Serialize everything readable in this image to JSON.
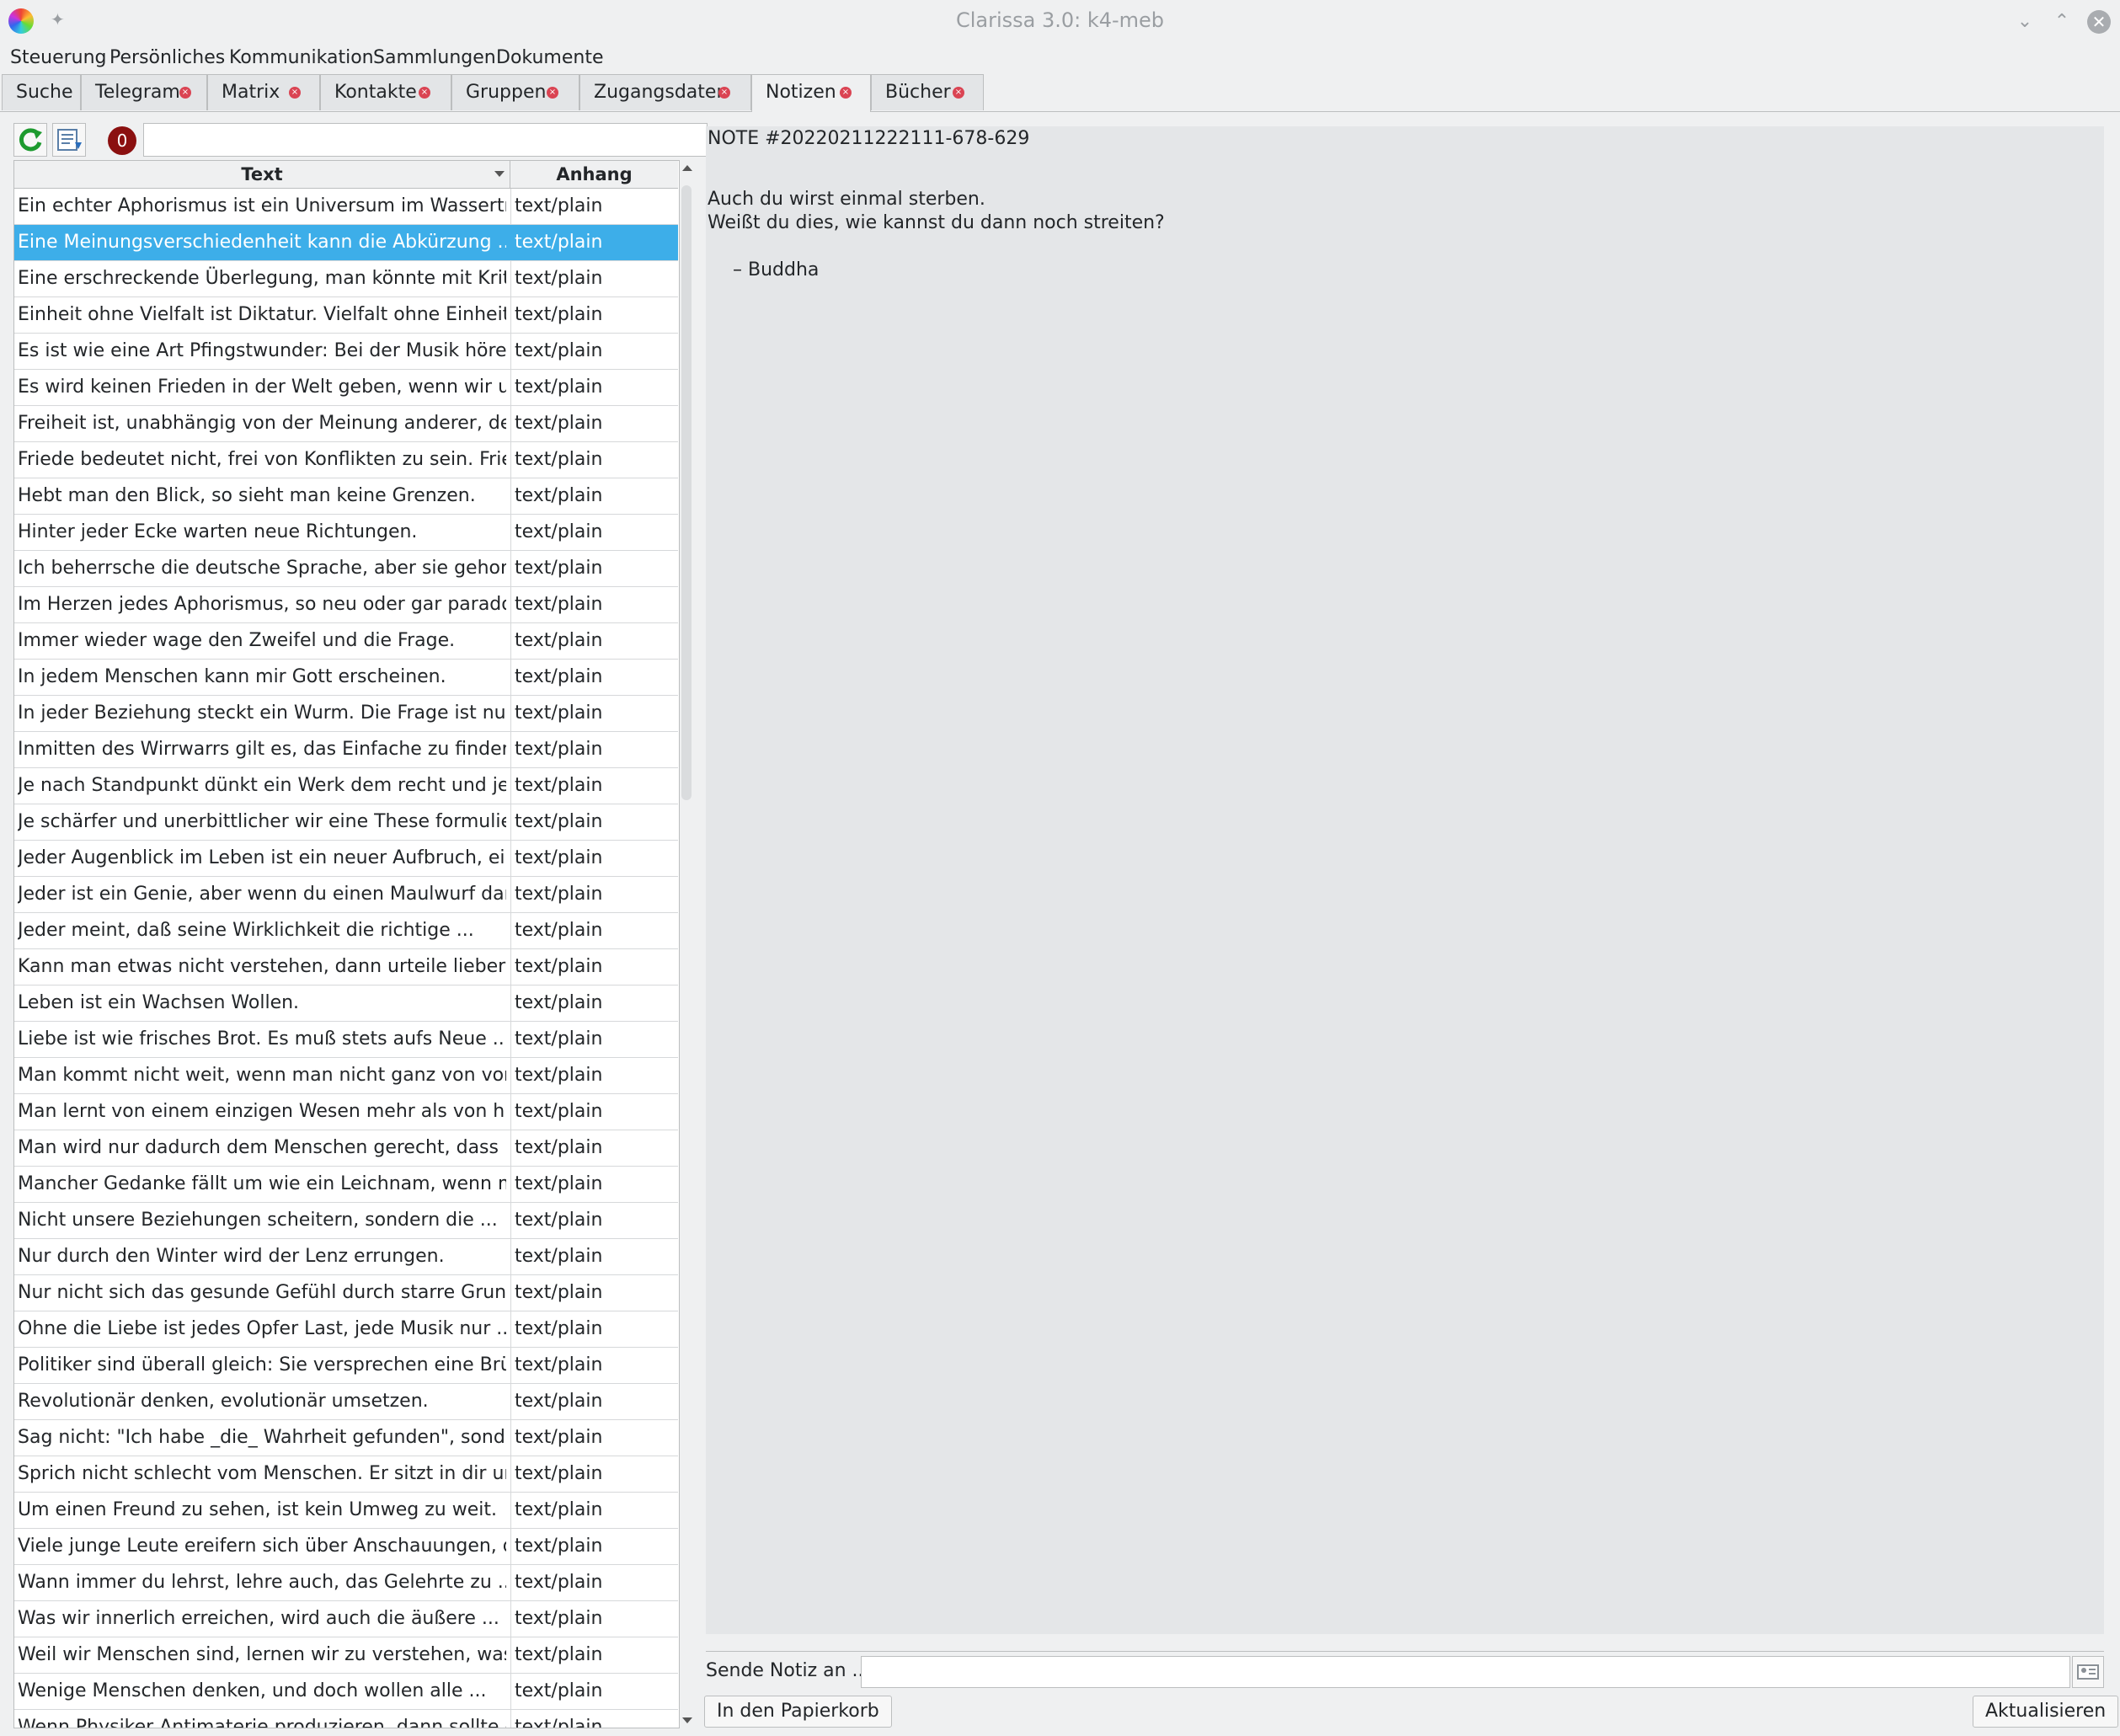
{
  "window": {
    "title": "Clarissa 3.0: k4-meb"
  },
  "menu": [
    "Steuerung",
    "Persönliches",
    "Kommunikation",
    "Sammlungen",
    "Dokumente"
  ],
  "tabs": [
    {
      "label": "Suche",
      "closable": false
    },
    {
      "label": "Telegram",
      "closable": true
    },
    {
      "label": "Matrix",
      "closable": true
    },
    {
      "label": "Kontakte",
      "closable": true
    },
    {
      "label": "Gruppen",
      "closable": true
    },
    {
      "label": "Zugangsdaten",
      "closable": true
    },
    {
      "label": "Notizen",
      "closable": true,
      "active": true
    },
    {
      "label": "Bücher",
      "closable": true
    }
  ],
  "toolbar": {
    "badge_count": "0",
    "filter_value": ""
  },
  "table": {
    "columns": [
      "Text",
      "Anhang"
    ],
    "selected_index": 1,
    "rows": [
      [
        "Ein echter Aphorismus ist ein Universum im Wassertropfen.",
        "text/plain"
      ],
      [
        "Eine Meinungsverschiedenheit kann die Abkürzung ...",
        "text/plain"
      ],
      [
        "Eine erschreckende Überlegung, man könnte mit Kritik ...",
        "text/plain"
      ],
      [
        "Einheit ohne Vielfalt ist Diktatur. Vielfalt ohne Einheit ...",
        "text/plain"
      ],
      [
        "Es ist wie eine Art Pfingstwunder: Bei der Musik hören di...",
        "text/plain"
      ],
      [
        "Es wird keinen Frieden in der Welt geben, wenn wir unser...",
        "text/plain"
      ],
      [
        "Freiheit ist, unabhängig von der Meinung anderer, der ...",
        "text/plain"
      ],
      [
        "Friede bedeutet nicht, frei von Konflikten zu sein. Friede i...",
        "text/plain"
      ],
      [
        "Hebt man den Blick, so sieht man keine Grenzen.",
        "text/plain"
      ],
      [
        "Hinter jeder Ecke warten neue Richtungen.",
        "text/plain"
      ],
      [
        "Ich beherrsche die deutsche Sprache, aber sie gehorcht ...",
        "text/plain"
      ],
      [
        "Im Herzen jedes Aphorismus, so neu oder gar paradox er ...",
        "text/plain"
      ],
      [
        "Immer wieder wage den Zweifel und die Frage.",
        "text/plain"
      ],
      [
        "In jedem Menschen kann mir Gott erscheinen.",
        "text/plain"
      ],
      [
        "In jeder Beziehung steckt ein Wurm. Die Frage ist nur, ob ...",
        "text/plain"
      ],
      [
        "Inmitten des Wirrwarrs gilt es, das Einfache zu finden.",
        "text/plain"
      ],
      [
        "Je nach Standpunkt dünkt ein Werk dem recht und jenem ...",
        "text/plain"
      ],
      [
        "Je schärfer und unerbittlicher wir eine These formulieren...",
        "text/plain"
      ],
      [
        "Jeder Augenblick im Leben ist ein neuer Aufbruch, ein En...",
        "text/plain"
      ],
      [
        "Jeder ist ein Genie, aber wenn du einen Maulwurf danach ...",
        "text/plain"
      ],
      [
        "Jeder meint, daß seine Wirklichkeit die richtige ...",
        "text/plain"
      ],
      [
        "Kann man etwas nicht verstehen, dann urteile lieber gar ...",
        "text/plain"
      ],
      [
        "Leben ist ein Wachsen Wollen.",
        "text/plain"
      ],
      [
        "Liebe ist wie frisches Brot. Es muß stets aufs Neue ...",
        "text/plain"
      ],
      [
        "Man kommt nicht weit, wenn man nicht ganz von vorne ...",
        "text/plain"
      ],
      [
        "Man lernt von einem einzigen Wesen mehr als von hundert.",
        "text/plain"
      ],
      [
        "Man wird nur dadurch dem Menschen gerecht, dass man i...",
        "text/plain"
      ],
      [
        "Mancher Gedanke fällt um wie ein Leichnam, wenn man i...",
        "text/plain"
      ],
      [
        "Nicht unsere Beziehungen scheitern, sondern die ...",
        "text/plain"
      ],
      [
        "Nur durch den Winter wird der Lenz errungen.",
        "text/plain"
      ],
      [
        "Nur nicht sich das gesunde Gefühl durch starre Grundsät...",
        "text/plain"
      ],
      [
        "Ohne die Liebe ist jedes Opfer Last, jede Musik nur ...",
        "text/plain"
      ],
      [
        "Politiker sind überall gleich: Sie versprechen eine Brücke, ...",
        "text/plain"
      ],
      [
        "Revolutionär denken, evolutionär umsetzen.",
        "text/plain"
      ],
      [
        "Sag nicht: \"Ich habe _die_ Wahrheit gefunden\", sondern ...",
        "text/plain"
      ],
      [
        "Sprich nicht schlecht vom Menschen. Er sitzt in dir und ...",
        "text/plain"
      ],
      [
        "Um einen Freund zu sehen, ist kein Umweg zu weit.",
        "text/plain"
      ],
      [
        "Viele junge Leute ereifern sich über Anschauungen, die si...",
        "text/plain"
      ],
      [
        "Wann immer du lehrst, lehre auch, das Gelehrte zu ...",
        "text/plain"
      ],
      [
        "Was wir innerlich erreichen, wird auch die äußere ...",
        "text/plain"
      ],
      [
        "Weil wir Menschen sind, lernen wir zu verstehen, was es ...",
        "text/plain"
      ],
      [
        "Wenige Menschen denken, und doch wollen alle ...",
        "text/plain"
      ],
      [
        "Wenn Physiker Antimaterie produzieren, dann sollte es da...",
        "text/plain"
      ]
    ]
  },
  "note": {
    "header": "NOTE #20220211222111-678-629",
    "lines": [
      "Auch du wirst einmal sterben.",
      "Weißt du dies, wie kannst du dann noch streiten?",
      "– Buddha"
    ]
  },
  "footer": {
    "send_label": "Sende Notiz an ...",
    "send_value": "",
    "trash_button": "In den Papierkorb",
    "update_button": "Aktualisieren"
  },
  "colors": {
    "selection": "#3daee9",
    "badge": "#8b1010",
    "tab_close": "#da4453"
  },
  "icons": [
    "app-logo-icon",
    "pin-icon",
    "minimize-icon",
    "maximize-icon",
    "close-icon",
    "refresh-icon",
    "export-icon",
    "sort-descending-icon",
    "contact-picker-icon"
  ]
}
